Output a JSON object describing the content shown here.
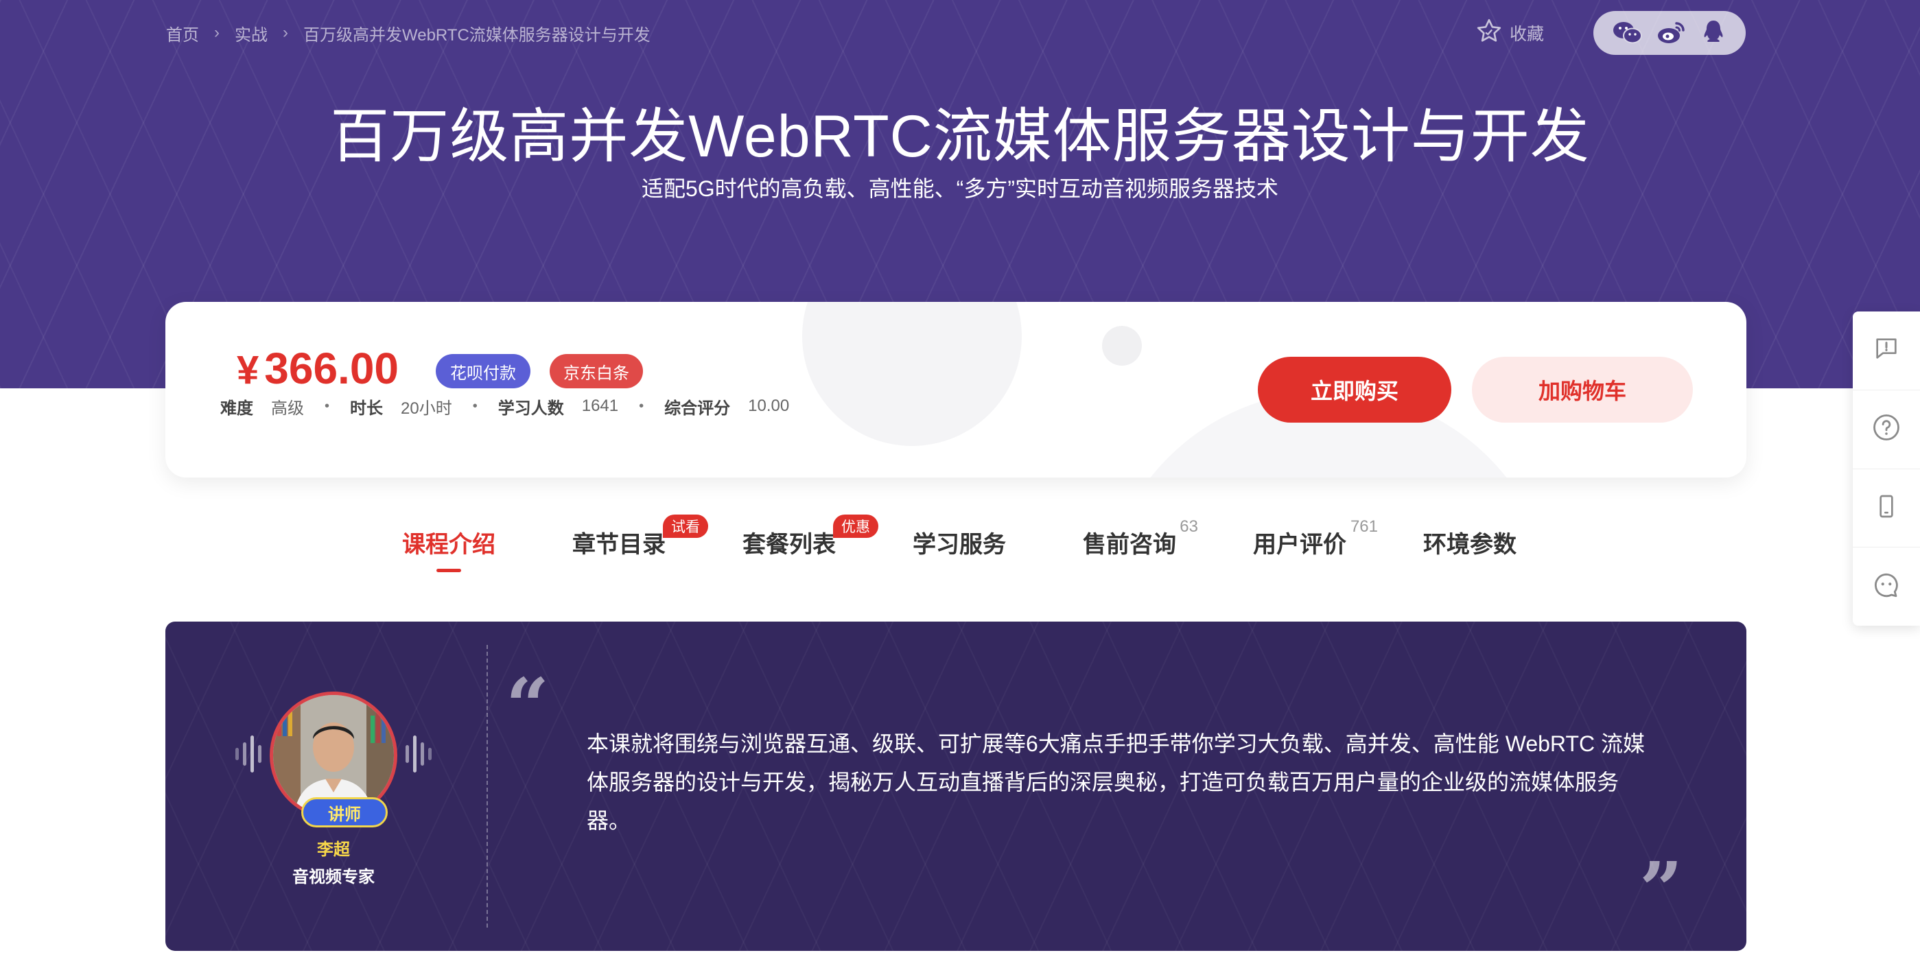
{
  "breadcrumb": {
    "items": [
      "首页",
      "实战",
      "百万级高并发WebRTC流媒体服务器设计与开发"
    ],
    "separator": "›"
  },
  "header": {
    "favorite_label": "收藏",
    "share_icons": [
      "wechat-icon",
      "weibo-icon",
      "qq-icon"
    ]
  },
  "course": {
    "title": "百万级高并发WebRTC流媒体服务器设计与开发",
    "subtitle": "适配5G时代的高负载、高性能、“多方”实时互动音视频服务器技术"
  },
  "price_card": {
    "currency": "¥",
    "price": "366.00",
    "badges": [
      "花呗付款",
      "京东白条"
    ],
    "meta": [
      {
        "key": "难度",
        "value": "高级"
      },
      {
        "key": "时长",
        "value": "20小时"
      },
      {
        "key": "学习人数",
        "value": "1641"
      },
      {
        "key": "综合评分",
        "value": "10.00"
      }
    ],
    "buy_label": "立即购买",
    "cart_label": "加购物车"
  },
  "tabs": [
    {
      "label": "课程介绍",
      "active": true
    },
    {
      "label": "章节目录",
      "tag": "试看"
    },
    {
      "label": "套餐列表",
      "tag": "优惠"
    },
    {
      "label": "学习服务"
    },
    {
      "label": "售前咨询",
      "count": "63"
    },
    {
      "label": "用户评价",
      "count": "761"
    },
    {
      "label": "环境参数"
    }
  ],
  "intro": {
    "role_badge": "讲师",
    "teacher_name": "李超",
    "teacher_title": "音视频专家",
    "quote_open": "“",
    "quote_close": "”",
    "text": "本课就将围绕与浏览器互通、级联、可扩展等6大痛点手把手带你学习大负载、高并发、高性能 WebRTC 流媒体服务器的设计与开发，揭秘万人互动直播背后的深层奥秘，打造可负载百万用户量的企业级的流媒体服务器。"
  },
  "side_tools": [
    "feedback-icon",
    "help-icon",
    "mobile-icon",
    "chat-icon"
  ],
  "colors": {
    "hero_bg": "#4a3988",
    "accent_red": "#e0312b",
    "intro_bg": "#34285e"
  }
}
